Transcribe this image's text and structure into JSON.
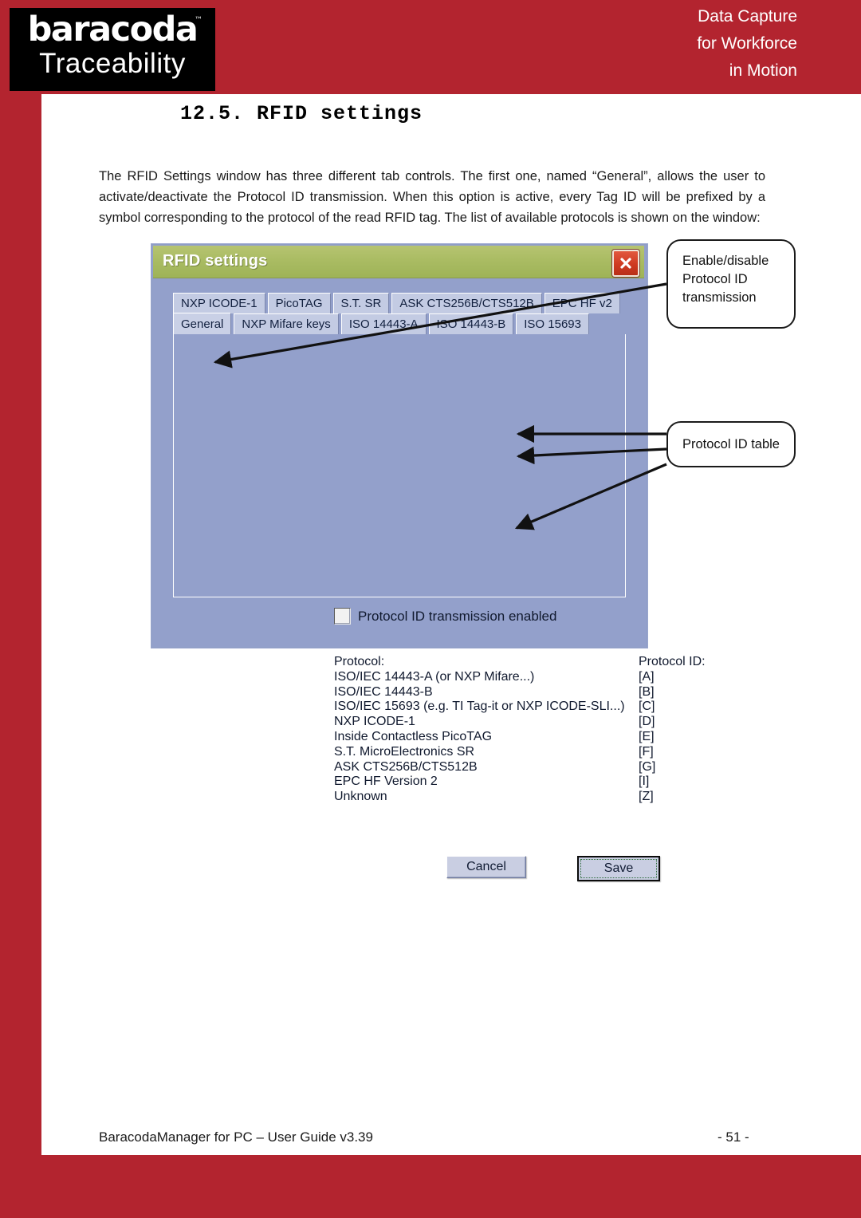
{
  "header": {
    "logo_primary": "baracoda",
    "logo_tm": "™",
    "logo_secondary": "Traceability",
    "tagline_line1": "Data Capture",
    "tagline_line2": "for Workforce",
    "tagline_line3": "in Motion",
    "brand_red": "#B3242F"
  },
  "section": {
    "heading": "12.5. RFID settings"
  },
  "body": {
    "paragraph": "The RFID Settings window has three different tab controls. The first one, named “General”, allows the user to activate/deactivate the Protocol ID transmission. When this option is active, every Tag ID will be prefixed by a symbol corresponding to the protocol of the read RFID tag. The list of available protocols is shown on the window:"
  },
  "dialog": {
    "title": "RFID settings",
    "close_label": "×",
    "tabs_top": [
      "NXP ICODE-1",
      "PicoTAG",
      "S.T. SR",
      "ASK CTS256B/CTS512B",
      "EPC HF v2"
    ],
    "tabs_bottom": [
      "General",
      "NXP Mifare keys",
      "ISO 14443-A",
      "ISO 14443-B",
      "ISO 15693"
    ],
    "active_tab": "General",
    "checkbox_label": "Protocol ID transmission enabled",
    "checkbox_checked": false,
    "table_header_protocol": "Protocol:",
    "table_header_id": "Protocol ID:",
    "protocols": [
      {
        "name": "ISO/IEC 14443-A (or NXP Mifare...)",
        "id": "[A]"
      },
      {
        "name": "ISO/IEC 14443-B",
        "id": "[B]"
      },
      {
        "name": "ISO/IEC 15693 (e.g. TI Tag-it or NXP ICODE-SLI...)",
        "id": "[C]"
      },
      {
        "name": "NXP ICODE-1",
        "id": "[D]"
      },
      {
        "name": "Inside Contactless PicoTAG",
        "id": "[E]"
      },
      {
        "name": "S.T. MicroElectronics SR",
        "id": "[F]"
      },
      {
        "name": "ASK CTS256B/CTS512B",
        "id": "[G]"
      },
      {
        "name": "EPC HF Version 2",
        "id": "[I]"
      },
      {
        "name": "Unknown",
        "id": "[Z]"
      }
    ],
    "cancel_label": "Cancel",
    "save_label": "Save",
    "titlebar_color": "#A9BB62",
    "body_color": "#93A0CB"
  },
  "callouts": {
    "enable": "Enable/disable Protocol ID transmission",
    "table": "Protocol ID table"
  },
  "footer": {
    "left": "BaracodaManager for PC – User Guide v3.39",
    "right": "- 51 -"
  }
}
